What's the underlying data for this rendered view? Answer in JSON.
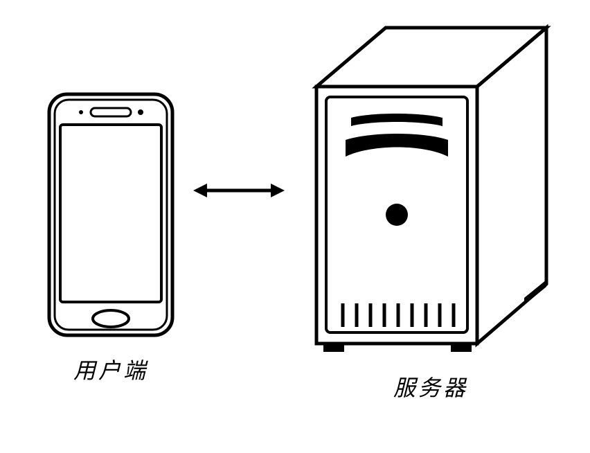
{
  "diagram": {
    "client": {
      "label": "用户端",
      "device_type": "smartphone"
    },
    "server": {
      "label": "服务器",
      "device_type": "server-tower"
    },
    "connection": {
      "type": "bidirectional"
    }
  }
}
